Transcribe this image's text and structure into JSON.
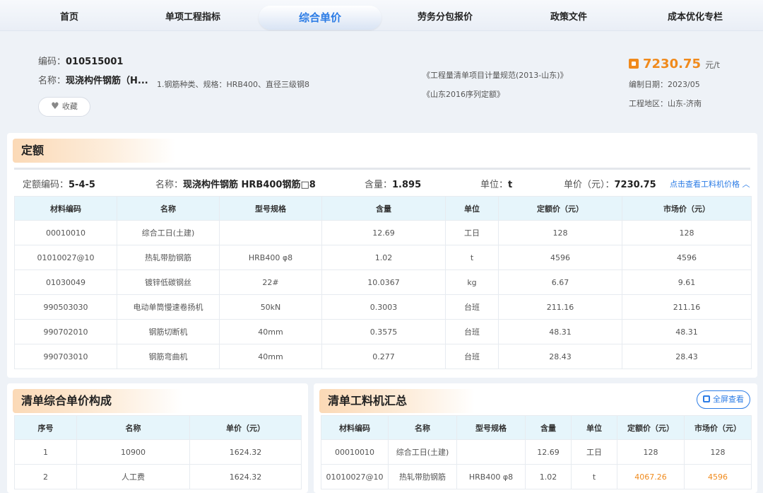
{
  "nav": {
    "items": [
      "首页",
      "单项工程指标",
      "综合单价",
      "劳务分包报价",
      "政策文件",
      "成本优化专栏"
    ]
  },
  "header": {
    "code_label": "编码：",
    "code": "010515001",
    "name_label": "名称：",
    "name": "现浇构件钢筋（H...",
    "feature": "1.钢筋种类、规格：HRB400、直径三级钢8",
    "favorite_label": "收藏",
    "standards": [
      "《工程量清单项目计量规范(2013-山东)》",
      "《山东2016序列定额》"
    ],
    "price": "7230.75",
    "price_unit": "元/t",
    "date_label": "编制日期：",
    "date": "2023/05",
    "region_label": "工程地区：",
    "region": "山东-济南"
  },
  "quota": {
    "title": "定额",
    "code_label": "定额编码：",
    "code": "5-4-5",
    "name_label": "名称：",
    "name": "现浇构件钢筋 HRB400钢筋□8",
    "qty_label": "含量：",
    "qty": "1.895",
    "unit_label": "单位：",
    "unit": "t",
    "price_label": "单价（元）：",
    "price": "7230.75",
    "link": "点击查看工料机价格",
    "columns": [
      "材料编码",
      "名称",
      "型号规格",
      "含量",
      "单位",
      "定额价（元）",
      "市场价（元）"
    ],
    "rows": [
      [
        "00010010",
        "综合工日(土建)",
        "",
        "12.69",
        "工日",
        "128",
        "128"
      ],
      [
        "01010027@10",
        "热轧带肋钢筋",
        "HRB400 φ8",
        "1.02",
        "t",
        "4596",
        "4596"
      ],
      [
        "01030049",
        "镀锌低碳钢丝",
        "22#",
        "10.0367",
        "kg",
        "6.67",
        "9.61"
      ],
      [
        "990503030",
        "电动单筒慢速卷扬机",
        "50kN",
        "0.3003",
        "台班",
        "211.16",
        "211.16"
      ],
      [
        "990702010",
        "钢筋切断机",
        "40mm",
        "0.3575",
        "台班",
        "48.31",
        "48.31"
      ],
      [
        "990703010",
        "钢筋弯曲机",
        "40mm",
        "0.277",
        "台班",
        "28.43",
        "28.43"
      ]
    ]
  },
  "composition": {
    "title": "清单综合单价构成",
    "columns": [
      "序号",
      "名称",
      "单价（元）"
    ],
    "rows": [
      [
        "1",
        "10900",
        "1624.32"
      ],
      [
        "2",
        "人工费",
        "1624.32"
      ]
    ]
  },
  "summary": {
    "title": "清单工料机汇总",
    "fullscreen_label": "全屏查看",
    "columns": [
      "材料编码",
      "名称",
      "型号规格",
      "含量",
      "单位",
      "定额价（元）",
      "市场价（元）"
    ],
    "rows": [
      [
        "00010010",
        "综合工日(土建)",
        "",
        "12.69",
        "工日",
        "128",
        "128"
      ],
      [
        "01010027@10",
        "热轧带肋钢筋",
        "HRB400 φ8",
        "1.02",
        "t",
        "4067.26",
        "4596"
      ]
    ]
  },
  "colors": {
    "accent": "#2c7ce5",
    "price": "#f08a1c",
    "header_bg": "#e6f5fb"
  }
}
